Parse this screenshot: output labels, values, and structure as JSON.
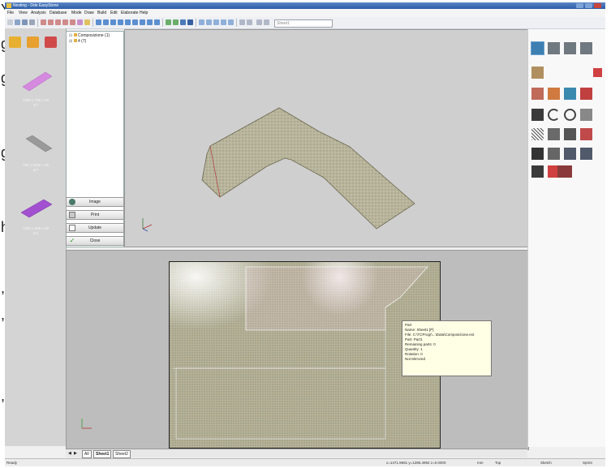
{
  "window": {
    "title": "Nesting - Dde EasyStone"
  },
  "menu": [
    "File",
    "View",
    "Analysis",
    "Database",
    "Mode",
    "Draw",
    "Build",
    "Edit",
    "Elaborate",
    "Help"
  ],
  "toolbar": {
    "sheet_combo": "Sheet1"
  },
  "left_strip": {
    "pieces": [
      {
        "label": "1000 x 795 x 30",
        "sub": "4/7"
      },
      {
        "label": "795 x 1000 x 30",
        "sub": "4/7"
      },
      {
        "label": "1000 x 595 x 30",
        "sub": "0/1"
      }
    ]
  },
  "tree": {
    "items": [
      "Composizione (1)",
      "4 (7)"
    ]
  },
  "actions": {
    "image": "Image",
    "print": "Print",
    "update": "Update",
    "close": "Close"
  },
  "tooltip": {
    "lines": [
      "Part",
      "Name: Sheet1 [P]",
      "File: C:\\TCProgr\\...\\Data\\Composizione.ext",
      "Part: Part1",
      "Remaining parts: 0",
      "Quantity: 1",
      "Rotation: 0",
      "Not Mirrored"
    ]
  },
  "tabs": [
    "All",
    "Sheet1",
    "Sheet2"
  ],
  "status": {
    "ready": "Ready",
    "coords": "x=1471.9691  y=1285.4992  z=0.0000",
    "units": "mm",
    "view": "Top",
    "mode": "Sketch",
    "snap": "Sprint"
  },
  "background_fragments": [
    "Y",
    "g",
    "g",
    "g",
    "h",
    ",",
    ",",
    ","
  ],
  "colors": {
    "titlebar": "#2d5ea8",
    "slab": "#b6b399",
    "piece_highlight": "#c46ad4"
  }
}
